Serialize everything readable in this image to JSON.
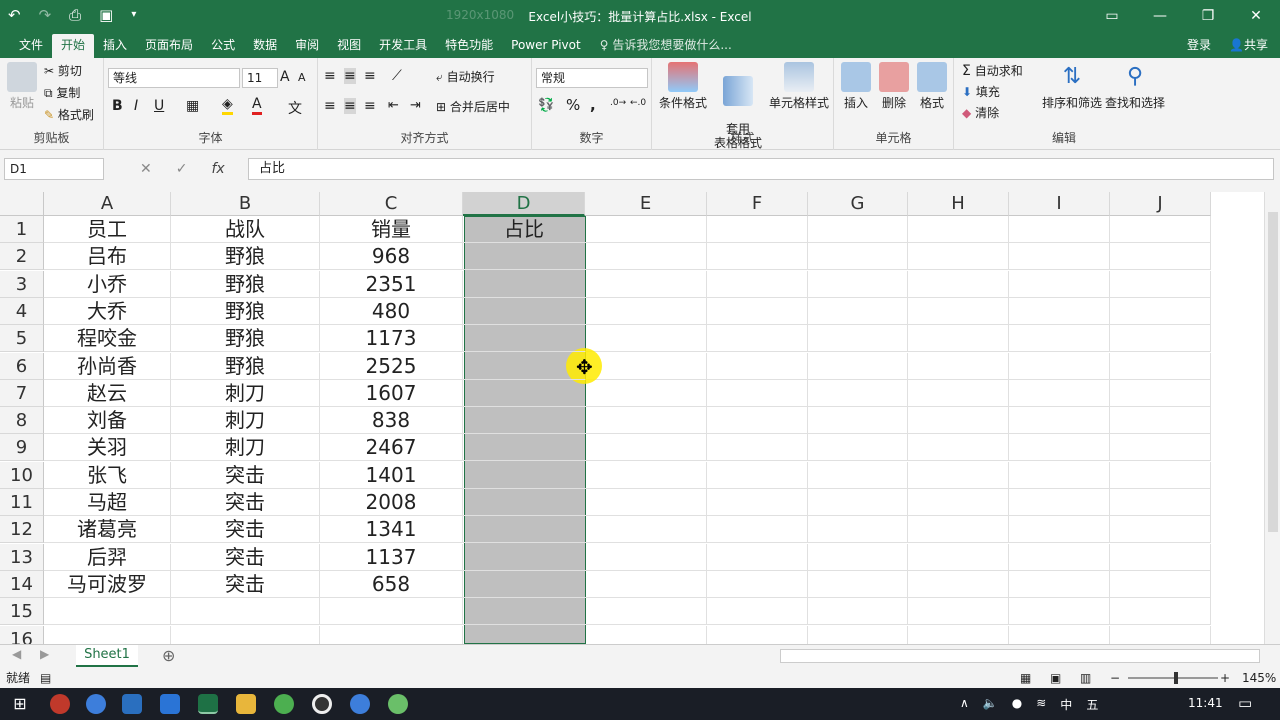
{
  "window": {
    "title": "Excel小技巧：批量计算占比.xlsx - Excel",
    "ghost_text": "1920x1080"
  },
  "ribbon_tabs": [
    "文件",
    "开始",
    "插入",
    "页面布局",
    "公式",
    "数据",
    "审阅",
    "视图",
    "开发工具",
    "特色功能",
    "Power Pivot"
  ],
  "tell_me": "告诉我您想要做什么...",
  "account": {
    "login": "登录",
    "share": "共享"
  },
  "clipboard": {
    "paste": "粘贴",
    "cut": "剪切",
    "copy": "复制",
    "format_painter": "格式刷",
    "label": "剪贴板"
  },
  "font": {
    "name": "等线",
    "size": "11",
    "bold": "B",
    "italic": "I",
    "underline": "U",
    "label": "字体",
    "grow": "A",
    "shrink": "A"
  },
  "alignment": {
    "wrap": "自动换行",
    "merge": "合并后居中",
    "label": "对齐方式"
  },
  "number": {
    "format": "常规",
    "percent": "%",
    "comma": ",",
    "label": "数字"
  },
  "styles": {
    "cond": "条件格式",
    "table": "套用\n表格格式",
    "cell": "单元格样式",
    "label": "样式"
  },
  "cells": {
    "insert": "插入",
    "delete": "删除",
    "format": "格式",
    "label": "单元格"
  },
  "editing": {
    "autosum": "自动求和",
    "fill": "填充",
    "clear": "清除",
    "sort": "排序和筛选",
    "find": "查找和选择",
    "label": "编辑"
  },
  "formula_bar": {
    "name_box": "D1",
    "fx": "fx",
    "content": "占比"
  },
  "columns": [
    "A",
    "B",
    "C",
    "D",
    "E",
    "F",
    "G",
    "H",
    "I",
    "J"
  ],
  "selected_column": "D",
  "rows": [
    {
      "n": "1",
      "a": "员工",
      "b": "战队",
      "c": "销量",
      "d": "占比"
    },
    {
      "n": "2",
      "a": "吕布",
      "b": "野狼",
      "c": "968",
      "d": ""
    },
    {
      "n": "3",
      "a": "小乔",
      "b": "野狼",
      "c": "2351",
      "d": ""
    },
    {
      "n": "4",
      "a": "大乔",
      "b": "野狼",
      "c": "480",
      "d": ""
    },
    {
      "n": "5",
      "a": "程咬金",
      "b": "野狼",
      "c": "1173",
      "d": ""
    },
    {
      "n": "6",
      "a": "孙尚香",
      "b": "野狼",
      "c": "2525",
      "d": ""
    },
    {
      "n": "7",
      "a": "赵云",
      "b": "刺刀",
      "c": "1607",
      "d": ""
    },
    {
      "n": "8",
      "a": "刘备",
      "b": "刺刀",
      "c": "838",
      "d": ""
    },
    {
      "n": "9",
      "a": "关羽",
      "b": "刺刀",
      "c": "2467",
      "d": ""
    },
    {
      "n": "10",
      "a": "张飞",
      "b": "突击",
      "c": "1401",
      "d": ""
    },
    {
      "n": "11",
      "a": "马超",
      "b": "突击",
      "c": "2008",
      "d": ""
    },
    {
      "n": "12",
      "a": "诸葛亮",
      "b": "突击",
      "c": "1341",
      "d": ""
    },
    {
      "n": "13",
      "a": "后羿",
      "b": "突击",
      "c": "1137",
      "d": ""
    },
    {
      "n": "14",
      "a": "马可波罗",
      "b": "突击",
      "c": "658",
      "d": ""
    },
    {
      "n": "15",
      "a": "",
      "b": "",
      "c": "",
      "d": ""
    },
    {
      "n": "16",
      "a": "",
      "b": "",
      "c": "",
      "d": ""
    }
  ],
  "sheet_tab": "Sheet1",
  "status": {
    "ready": "就绪",
    "zoom": "145%"
  },
  "taskbar": {
    "time": "11:41",
    "ime1": "中",
    "ime2": "五"
  }
}
